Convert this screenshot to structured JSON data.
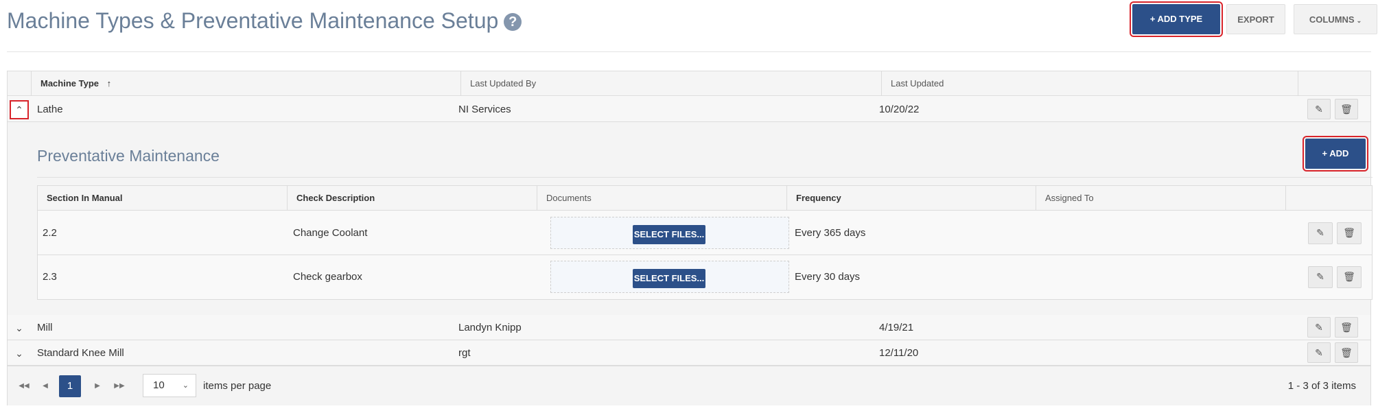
{
  "header": {
    "title": "Machine Types & Preventative Maintenance Setup",
    "help_icon": "?",
    "add_type_label": "+ ADD TYPE",
    "export_label": "EXPORT",
    "columns_label": "COLUMNS"
  },
  "grid": {
    "columns": [
      "Machine Type",
      "Last Updated By",
      "Last Updated"
    ],
    "sort_indicator": "↑",
    "rows": [
      {
        "type": "Lathe",
        "updated_by": "NI Services",
        "updated": "10/20/22",
        "expanded": true
      },
      {
        "type": "Mill",
        "updated_by": "Landyn Knipp",
        "updated": "4/19/21",
        "expanded": false
      },
      {
        "type": "Standard Knee Mill",
        "updated_by": "rgt",
        "updated": "12/11/20",
        "expanded": false
      }
    ]
  },
  "pm": {
    "title": "Preventative Maintenance",
    "add_label": "+ ADD",
    "columns": [
      "Section In Manual",
      "Check Description",
      "Documents",
      "Frequency",
      "Assigned To"
    ],
    "select_files_label": "SELECT FILES...",
    "rows": [
      {
        "section": "2.2",
        "description": "Change Coolant",
        "frequency": "Every 365 days",
        "assigned": ""
      },
      {
        "section": "2.3",
        "description": "Check gearbox",
        "frequency": "Every 30 days",
        "assigned": ""
      }
    ]
  },
  "pager": {
    "current_page": "1",
    "page_size": "10",
    "per_page_label": "items per page",
    "info": "1 - 3 of 3 items"
  },
  "icons": {
    "edit": "edit-icon",
    "delete": "trash-icon",
    "expand": "chevron-down-icon",
    "collapse": "chevron-up-icon"
  },
  "colors": {
    "primary": "#2c5089",
    "title": "#6a7f98",
    "highlight": "#d8232a"
  }
}
